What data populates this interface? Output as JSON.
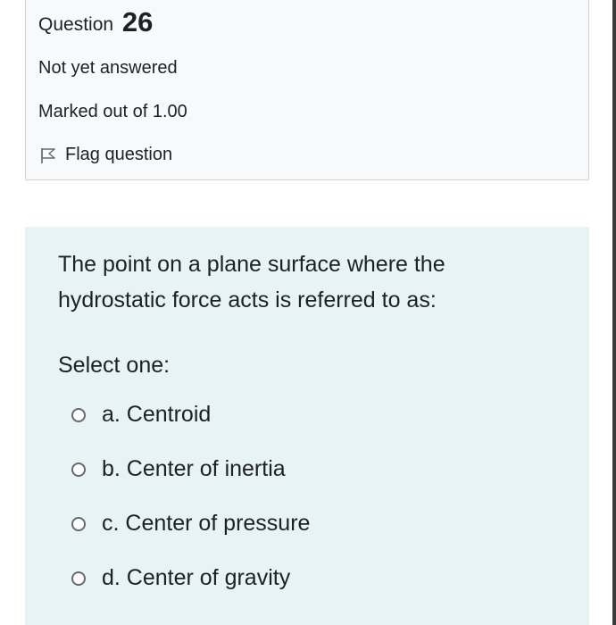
{
  "info": {
    "question_label": "Question",
    "question_number": "26",
    "state": "Not yet answered",
    "grade": "Marked out of 1.00",
    "flag_label": "Flag question"
  },
  "question": {
    "text": "The point on a plane surface where the hydrostatic force acts is referred to as:",
    "prompt": "Select one:",
    "answers": [
      {
        "label": "a. Centroid"
      },
      {
        "label": "b. Center of inertia"
      },
      {
        "label": "c. Center of pressure"
      },
      {
        "label": "d. Center of gravity"
      }
    ]
  },
  "colors": {
    "info_background": "#f8f9fa",
    "content_background": "#e7f3f5",
    "text": "#1d2125"
  },
  "icons": {
    "flag": "flag-icon",
    "radio": "radio-unchecked-icon"
  }
}
